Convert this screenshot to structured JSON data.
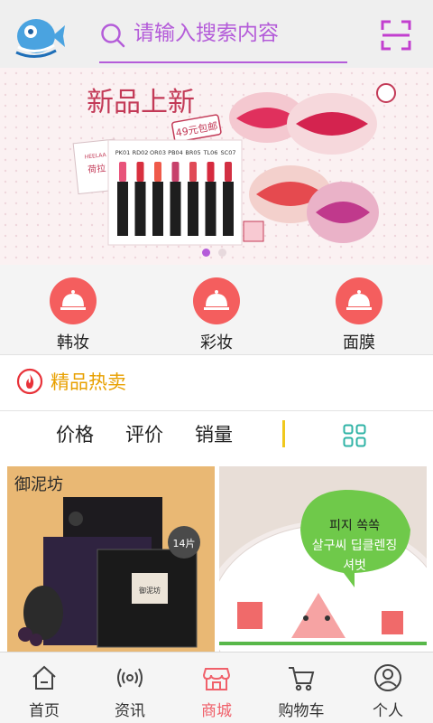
{
  "header": {
    "search_placeholder": "请输入搜索内容"
  },
  "banner": {
    "headline": "新品上新",
    "price_tag": "49元包邮",
    "brand_small": "HEELAA",
    "brand_cn": "荷拉",
    "shades": [
      "PK01",
      "RD02",
      "OR03",
      "PB04",
      "BR05",
      "TL06",
      "SC07"
    ],
    "slide_index": 1,
    "slide_count": 2
  },
  "categories": [
    {
      "label": "韩妆"
    },
    {
      "label": "彩妆"
    },
    {
      "label": "面膜"
    }
  ],
  "section": {
    "title": "精品热卖"
  },
  "sort": {
    "price": "价格",
    "review": "评价",
    "sales": "销量"
  },
  "products": [
    {
      "brand": "御泥坊",
      "badge": "14片",
      "box_text": "御泥坊"
    },
    {
      "tag_line1": "피지 쏙쏙",
      "tag_line2": "살구씨 딥클렌징",
      "tag_line3": "셔벗"
    }
  ],
  "nav": [
    {
      "label": "首页",
      "icon": "home-icon"
    },
    {
      "label": "资讯",
      "icon": "broadcast-icon"
    },
    {
      "label": "商城",
      "icon": "store-icon",
      "active": true
    },
    {
      "label": "购物车",
      "icon": "cart-icon"
    },
    {
      "label": "个人",
      "icon": "user-icon"
    }
  ],
  "colors": {
    "accent": "#b45cd9",
    "category_circle": "#f45e5e",
    "hot_title": "#e8a000",
    "nav_active": "#f0606a",
    "divider_yellow": "#f0c81c",
    "grid_icon": "#2fb3a6"
  }
}
